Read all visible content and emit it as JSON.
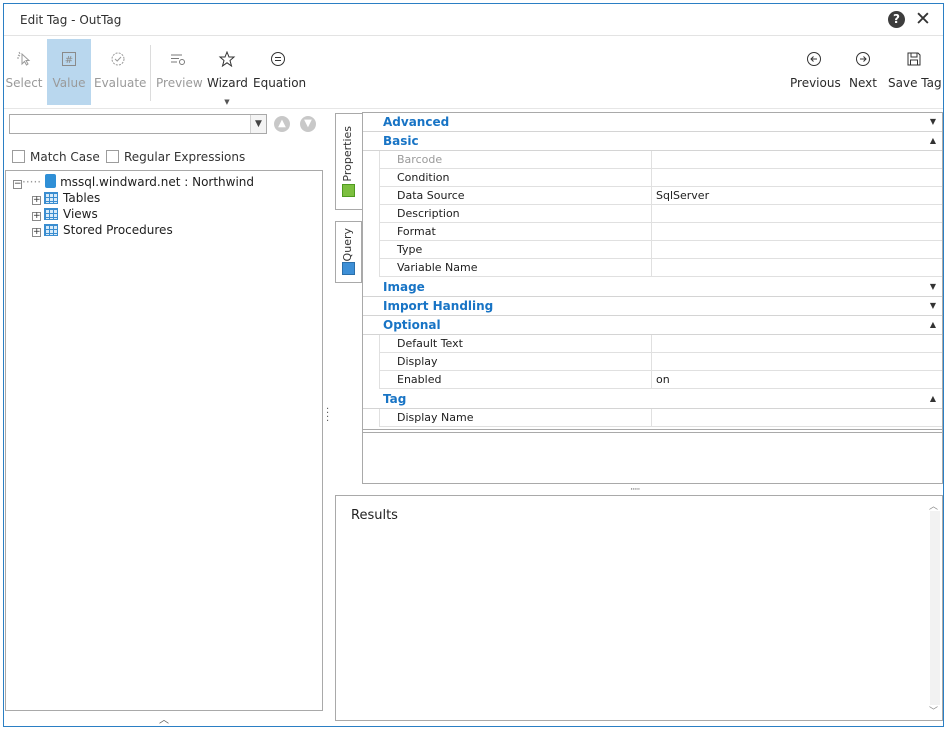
{
  "window": {
    "title": "Edit Tag - OutTag"
  },
  "toolbar": {
    "select": "Select",
    "value": "Value",
    "evaluate": "Evaluate",
    "preview": "Preview",
    "wizard": "Wizard",
    "equation": "Equation",
    "previous": "Previous",
    "next": "Next",
    "save_tag": "Save Tag"
  },
  "left": {
    "search_value": "",
    "match_case": "Match Case",
    "regular_expressions": "Regular Expressions",
    "tree": {
      "root": "mssql.windward.net : Northwind",
      "children": [
        "Tables",
        "Views",
        "Stored Procedures"
      ]
    }
  },
  "tabs": {
    "properties": "Properties",
    "query": "Query"
  },
  "properties": {
    "categories": {
      "advanced": "Advanced",
      "basic": "Basic",
      "image": "Image",
      "import_handling": "Import Handling",
      "optional": "Optional",
      "tag": "Tag"
    },
    "basic": [
      {
        "name": "Barcode",
        "value": ""
      },
      {
        "name": "Condition",
        "value": ""
      },
      {
        "name": "Data Source",
        "value": "SqlServer"
      },
      {
        "name": "Description",
        "value": ""
      },
      {
        "name": "Format",
        "value": ""
      },
      {
        "name": "Type",
        "value": ""
      },
      {
        "name": "Variable Name",
        "value": ""
      }
    ],
    "optional": [
      {
        "name": "Default Text",
        "value": ""
      },
      {
        "name": "Display",
        "value": ""
      },
      {
        "name": "Enabled",
        "value": "on"
      }
    ],
    "tag": [
      {
        "name": "Display Name",
        "value": ""
      }
    ]
  },
  "results": {
    "title": "Results"
  }
}
